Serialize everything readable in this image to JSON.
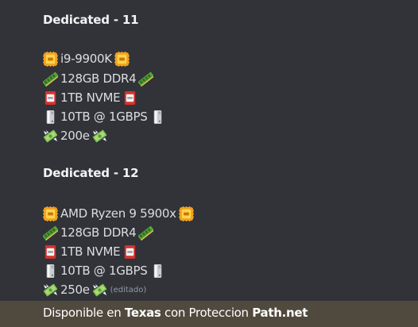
{
  "colors": {
    "background": "#313338",
    "text": "#dbdee1",
    "heading": "#f2f3f5",
    "footer_bg": "#50493d",
    "muted": "#949ba4"
  },
  "blocks": [
    {
      "title": "Dedicated - 11",
      "specs": [
        {
          "icon": "cpu-icon",
          "text": "i9-9900K",
          "trail_icon": "cpu-icon"
        },
        {
          "icon": "memory-stick-icon",
          "text": "128GB DDR4",
          "trail_icon": "memory-stick-icon"
        },
        {
          "icon": "ssd-icon",
          "text": "1TB NVME",
          "trail_icon": "ssd-icon"
        },
        {
          "icon": "server-tower-icon",
          "text": "10TB @ 1GBPS",
          "trail_icon": "server-tower-icon"
        },
        {
          "icon": "money-wings-icon",
          "text": "200e",
          "trail_icon": "money-wings-icon"
        }
      ]
    },
    {
      "title": "Dedicated - 12",
      "specs": [
        {
          "icon": "cpu-icon",
          "text": "AMD Ryzen 9 5900x",
          "trail_icon": "cpu-icon"
        },
        {
          "icon": "memory-stick-icon",
          "text": "128GB DDR4",
          "trail_icon": "memory-stick-icon"
        },
        {
          "icon": "ssd-icon",
          "text": "1TB NVME",
          "trail_icon": "ssd-icon"
        },
        {
          "icon": "server-tower-icon",
          "text": "10TB @ 1GBPS",
          "trail_icon": "server-tower-icon"
        },
        {
          "icon": "money-wings-icon",
          "text": "250e",
          "trail_icon": "money-wings-icon"
        }
      ]
    }
  ],
  "edited_label": "(editado)",
  "footer": {
    "prefix": "Disponible en ",
    "location": "Texas",
    "middle": " con Proteccion ",
    "provider": "Path.net"
  }
}
